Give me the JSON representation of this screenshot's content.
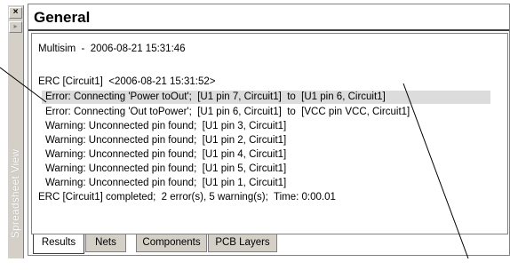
{
  "window": {
    "close_glyph": "×",
    "dock_glyph": "▸",
    "side_label": "Spreadsheet View"
  },
  "panel": {
    "title": "General"
  },
  "log": {
    "lines": [
      "Multisim  -  2006-08-21 15:31:46",
      "",
      "ERC [Circuit1]  <2006-08-21 15:31:52>",
      "Error: Connecting 'Power toOut';  [U1 pin 7, Circuit1]  to  [U1 pin 6, Circuit1]",
      "Error: Connecting 'Out toPower';  [U1 pin 6, Circuit1]  to  [VCC pin VCC, Circuit1]",
      "Warning: Unconnected pin found;  [U1 pin 3, Circuit1]",
      "Warning: Unconnected pin found;  [U1 pin 2, Circuit1]",
      "Warning: Unconnected pin found;  [U1 pin 4, Circuit1]",
      "Warning: Unconnected pin found;  [U1 pin 5, Circuit1]",
      "Warning: Unconnected pin found;  [U1 pin 1, Circuit1]",
      "ERC [Circuit1] completed;  2 error(s), 5 warning(s);  Time: 0:00.01"
    ]
  },
  "tabs": [
    {
      "label": "Results",
      "active": true
    },
    {
      "label": "Nets",
      "active": false
    },
    {
      "label": "Components",
      "active": false
    },
    {
      "label": "PCB Layers",
      "active": false
    }
  ]
}
